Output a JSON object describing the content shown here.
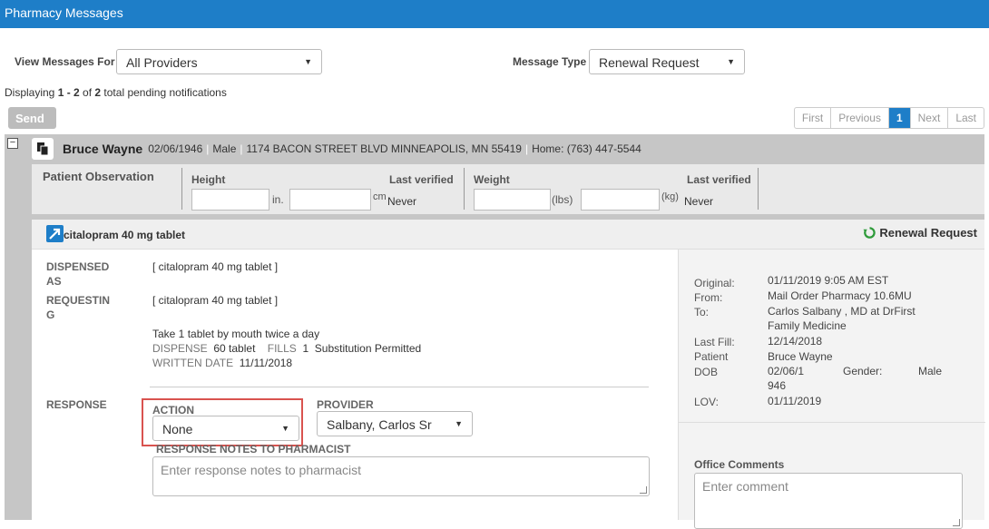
{
  "app": {
    "title": "Pharmacy Messages"
  },
  "filters": {
    "view_label": "View Messages For",
    "view_value": "All Providers",
    "type_label": "Message Type",
    "type_value": "Renewal Request"
  },
  "display": {
    "prefix": "Displaying ",
    "range": "1 - 2",
    "middle": " of ",
    "total": "2",
    "suffix": " total pending notifications"
  },
  "toolbar": {
    "send_label": "Send"
  },
  "pager": {
    "first": "First",
    "previous": "Previous",
    "current": "1",
    "next": "Next",
    "last": "Last"
  },
  "patient": {
    "name": "Bruce Wayne",
    "dob": "02/06/1946",
    "sex": "Male",
    "address": "1174 BACON STREET BLVD MINNEAPOLIS, MN 55419",
    "phone": "Home: (763) 447-5544"
  },
  "observation": {
    "title": "Patient Observation",
    "height_label": "Height",
    "height_unit1": "in.",
    "height_unit2": "cm",
    "height_last_label": "Last verified",
    "height_last_value": "Never",
    "weight_label": "Weight",
    "weight_unit1": "(lbs)",
    "weight_unit2": "(kg)",
    "weight_last_label": "Last verified",
    "weight_last_value": "Never"
  },
  "medication": {
    "name": "citalopram 40 mg tablet",
    "status": "Renewal Request",
    "dispensed_label_1": "DISPENSED",
    "dispensed_label_2": "AS",
    "dispensed_value": "[ citalopram 40 mg tablet ]",
    "requesting_label_1": "REQUESTIN",
    "requesting_label_2": "G",
    "requesting_value": "[ citalopram 40 mg tablet ]",
    "sig": "Take 1 tablet by mouth twice a day",
    "dispense_label": "DISPENSE",
    "dispense_value": "60 tablet",
    "fills_label": "FILLS",
    "fills_value": "1",
    "substitution": "Substitution Permitted",
    "written_label": "WRITTEN DATE",
    "written_value": "11/11/2018"
  },
  "response": {
    "label": "RESPONSE",
    "action_label": "ACTION",
    "action_value": "None",
    "provider_label": "PROVIDER",
    "provider_value": "Salbany, Carlos Sr",
    "notes_label": "RESPONSE NOTES TO PHARMACIST",
    "notes_placeholder": "Enter response notes to pharmacist"
  },
  "details": {
    "original_label": "Original:",
    "original_value": "01/11/2019 9:05 AM EST",
    "from_label": "From:",
    "from_value": "Mail Order Pharmacy 10.6MU",
    "to_label": "To:",
    "to_value_1": "Carlos Salbany , MD at DrFirst",
    "to_value_2": "Family Medicine",
    "lastfill_label": "Last Fill:",
    "lastfill_value": "12/14/2018",
    "patient_label": "Patient",
    "patient_value": "Bruce Wayne",
    "dob_label": "DOB",
    "dob_value_1": "02/06/1",
    "dob_value_2": "946",
    "gender_label": "Gender:",
    "gender_value": "Male",
    "lov_label": "LOV:",
    "lov_value": "01/11/2019",
    "comments_label": "Office Comments",
    "comments_placeholder": "Enter comment"
  },
  "colors": {
    "brand": "#1e7ec8",
    "highlight": "#d9534f",
    "renew_icon": "#2e9b3a"
  },
  "icons": {
    "collapse": "collapse-minus-icon",
    "patient": "patient-card-icon",
    "med": "rx-arrow-icon",
    "renew": "refresh-icon"
  }
}
